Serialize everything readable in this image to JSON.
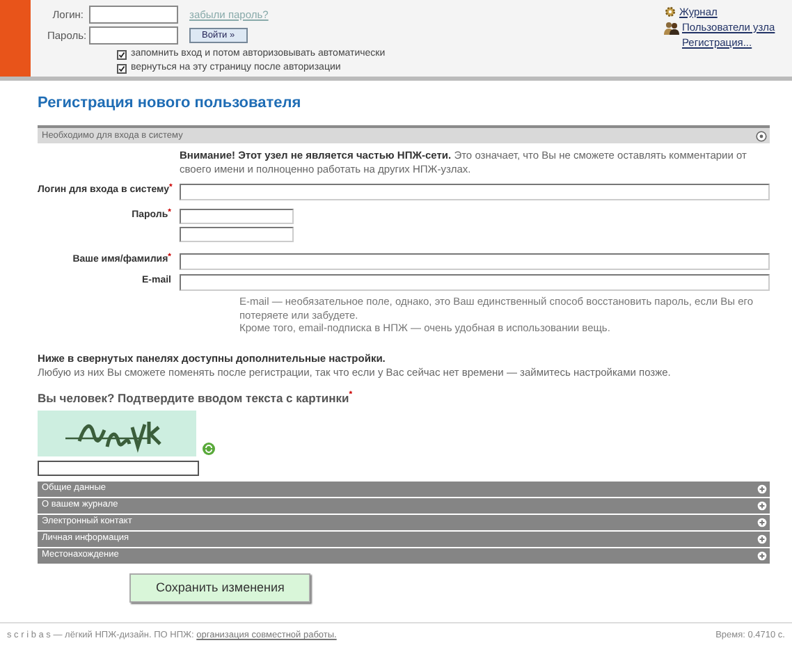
{
  "header": {
    "login": {
      "label": "Логин:"
    },
    "password": {
      "label": "Пароль:"
    },
    "forgot_link": "забыли пароль?",
    "login_button": "Войти »",
    "checkboxes": [
      {
        "label": "запомнить вход и потом авторизовывать автоматически",
        "checked": true
      },
      {
        "label": "вернуться на эту страницу после авторизации",
        "checked": true
      }
    ],
    "nav_links": [
      {
        "label": "Журнал",
        "kind": "journal"
      },
      {
        "label": "Пользователи узла",
        "kind": "users"
      },
      {
        "label": "Регистрация...",
        "kind": "none"
      }
    ]
  },
  "page_title": "Регистрация нового пользователя",
  "section": {
    "title": "Необходимо для входа в систему",
    "notice_bold": "Внимание! Этот узел не является частью НПЖ-сети.",
    "notice_text": "Это означает, что Вы не сможете оставлять комментарии от своего имени и полноценно работать на других НПЖ-узлах."
  },
  "fields": [
    {
      "label": "Логин для входа в систему",
      "mark": "*",
      "kind": "text"
    },
    {
      "label": "Пароль",
      "mark": "*",
      "kind": "password"
    },
    {
      "label": "Ваше имя/фамилия",
      "mark": "*",
      "kind": "text"
    },
    {
      "label": "E-mail",
      "kind": "text"
    }
  ],
  "email_hint": [
    "E-mail — необязательное поле, однако, это Ваш единственный способ восстановить пароль, если Вы его потеряете или забудете.",
    "Кроме того, email-подписка в НПЖ — очень удобная в использовании вещь."
  ],
  "extra_note": {
    "bold": "Ниже в свернутых панелях доступны дополнительные настройки.",
    "text": "Любую из них Вы сможете поменять после регистрации, так что если у Вас сейчас нет времени — займитесь настройками позже."
  },
  "captcha": {
    "question": "Вы человек? Подтвердите вводом текста с картинки",
    "mark": "*"
  },
  "panels": [
    {
      "title": "Общие данные",
      "expanded": false
    },
    {
      "title": "О вашем журнале",
      "expanded": false
    },
    {
      "title": "Электронный контакт",
      "expanded": false
    },
    {
      "title": "Личная информация",
      "expanded": false
    },
    {
      "title": "Местонахождение",
      "expanded": false
    }
  ],
  "save_button": "Сохранить изменения",
  "footer": {
    "brand": "s c r i b a s",
    "text": "— лёгкий НПЖ-дизайн. ПО НПЖ:",
    "link": "организация совместной работы.",
    "timing": "Время: 0.4710 с."
  }
}
